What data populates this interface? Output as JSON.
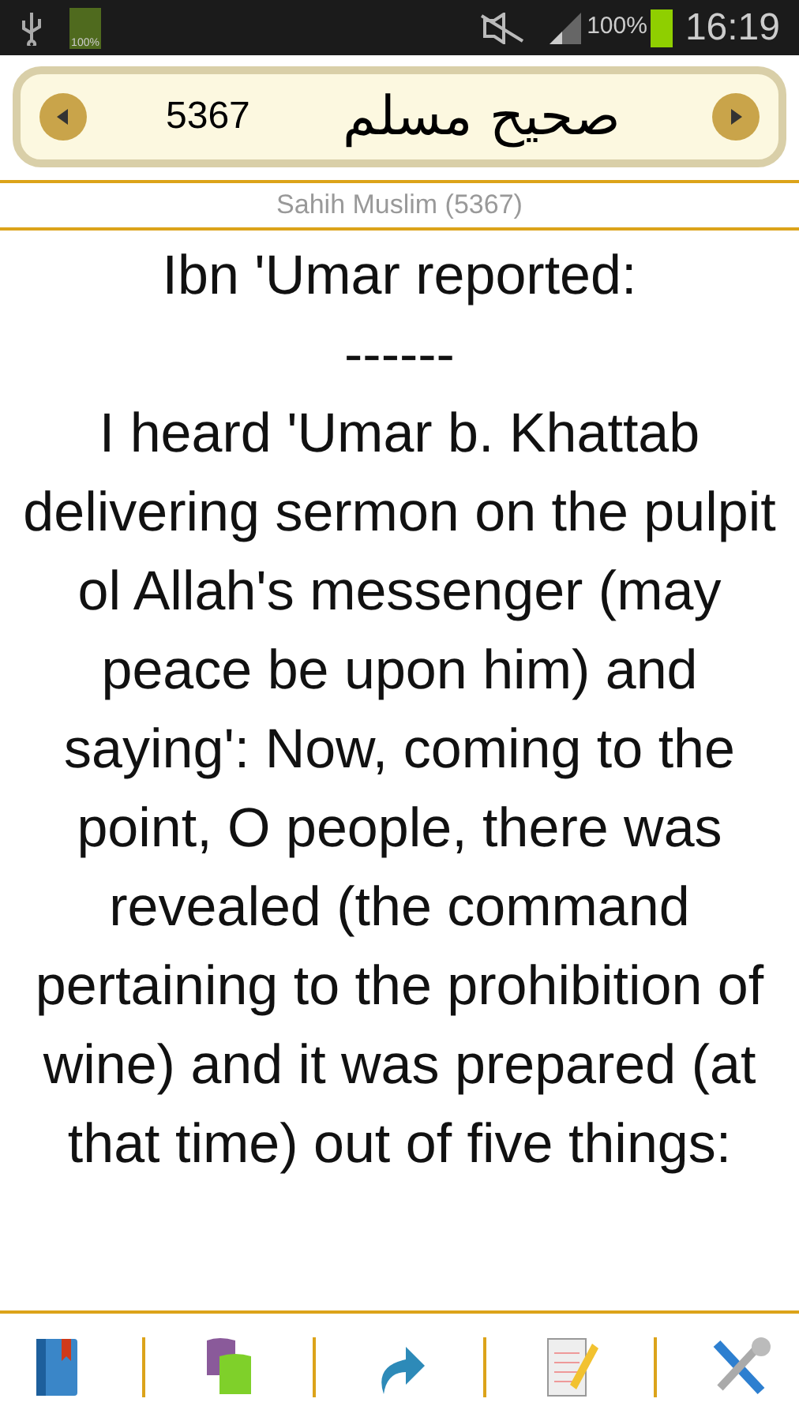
{
  "status_bar": {
    "battery_small_label": "100%",
    "battery_percent": "100%",
    "time": "16:19"
  },
  "header": {
    "number": "5367",
    "title": "صحيح مسلم"
  },
  "subtitle": "Sahih Muslim (5367)",
  "hadith": {
    "narrator": "Ibn 'Umar reported:",
    "separator": "------",
    "text": "I heard 'Umar b. Khattab delivering sermon on the pulpit ol Allah's messenger (may peace be upon him) and saying': Now, coming to the point, O people, there was revealed (the command pertaining to the prohibition of wine) and it was prepared (at that time) out of five things:"
  },
  "toolbar": [
    {
      "kind": "bookmark"
    },
    {
      "kind": "pages"
    },
    {
      "kind": "share"
    },
    {
      "kind": "notes"
    },
    {
      "kind": "settings"
    }
  ]
}
